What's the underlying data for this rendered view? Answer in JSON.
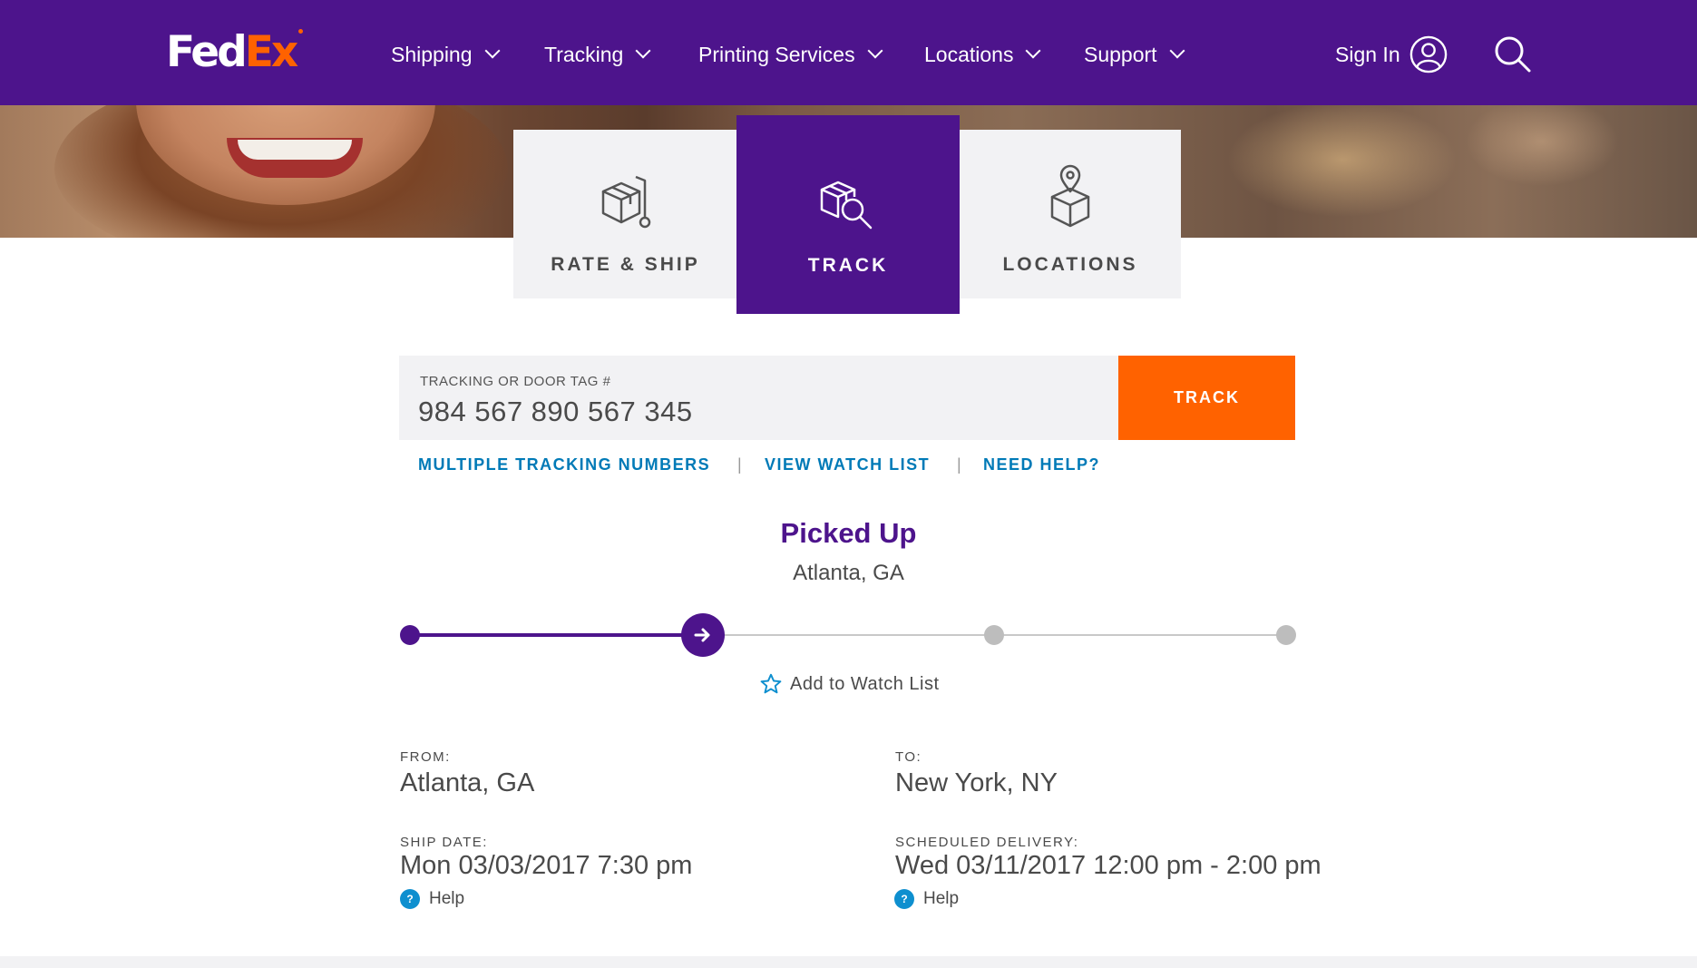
{
  "brand": {
    "name_fed": "Fed",
    "name_ex": "Ex",
    "primary": "#4d148c",
    "accent": "#ff6200",
    "link": "#007ab7"
  },
  "nav": {
    "items": [
      {
        "label": "Shipping"
      },
      {
        "label": "Tracking"
      },
      {
        "label": "Printing Services"
      },
      {
        "label": "Locations"
      },
      {
        "label": "Support"
      }
    ],
    "sign_in": "Sign In",
    "icons": {
      "account": "user-circle-icon",
      "search": "search-icon",
      "dropdown": "chevron-down-icon"
    }
  },
  "tabs": [
    {
      "label": "RATE & SHIP",
      "icon": "box-on-hand-truck-icon",
      "active": false
    },
    {
      "label": "TRACK",
      "icon": "box-magnifier-icon",
      "active": true
    },
    {
      "label": "LOCATIONS",
      "icon": "box-location-pin-icon",
      "active": false
    }
  ],
  "tracking": {
    "field_label": "TRACKING OR DOOR TAG #",
    "value": "984 567 890 567 345",
    "button": "TRACK",
    "links": [
      "MULTIPLE TRACKING NUMBERS",
      "VIEW WATCH LIST",
      "NEED HELP?"
    ],
    "separator": "|"
  },
  "status": {
    "title": "Picked Up",
    "location": "Atlanta, GA",
    "progress": {
      "total_steps": 4,
      "current_step": 2
    },
    "watch_label": "Add to Watch List"
  },
  "details": {
    "from_label": "FROM:",
    "from": "Atlanta, GA",
    "to_label": "TO:",
    "to": "New York, NY",
    "ship_date_label": "SHIP DATE:",
    "ship_date": "Mon 03/03/2017 7:30 pm",
    "delivery_label": "SCHEDULED DELIVERY:",
    "delivery": "Wed 03/11/2017 12:00 pm - 2:00 pm",
    "help_label": "Help",
    "help_icon_glyph": "?"
  }
}
